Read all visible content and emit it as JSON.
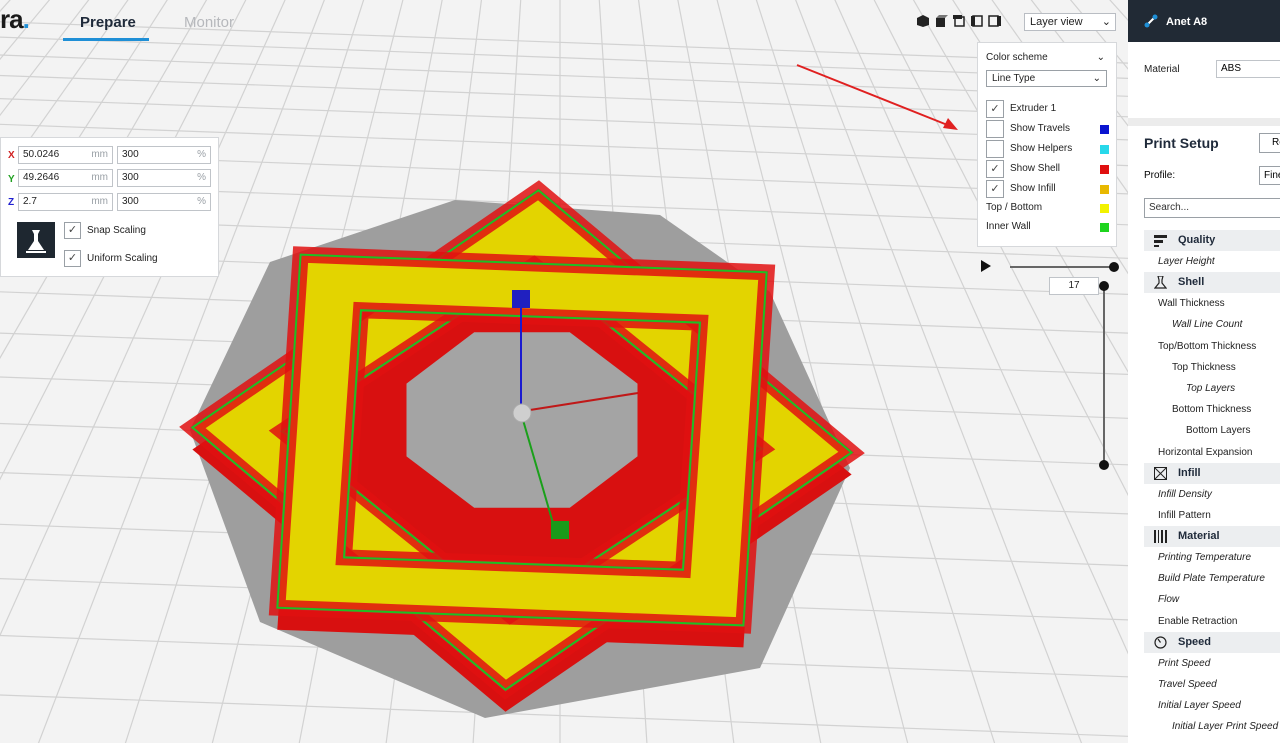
{
  "app": {
    "logo_text": "ra",
    "logo_dot": "."
  },
  "tabs": {
    "prepare": "Prepare",
    "monitor": "Monitor"
  },
  "view": {
    "selected": "Layer view",
    "icons": [
      "3d-view-icon",
      "front-view-icon",
      "top-view-icon",
      "left-view-icon",
      "right-view-icon"
    ]
  },
  "layer_panel": {
    "color_scheme_label": "Color scheme",
    "scheme_value": "Line Type",
    "items": [
      {
        "label": "Extruder 1",
        "checked": "✓"
      },
      {
        "label": "Show Travels",
        "checked": "",
        "color": "#0a14d0"
      },
      {
        "label": "Show Helpers",
        "checked": "",
        "color": "#28d8ea"
      },
      {
        "label": "Show Shell",
        "checked": "✓",
        "color": "#e01010"
      },
      {
        "label": "Show Infill",
        "checked": "✓",
        "color": "#e8b800"
      }
    ],
    "legend": [
      {
        "label": "Top / Bottom",
        "color": "#f2f200"
      },
      {
        "label": "Inner Wall",
        "color": "#1ed41e"
      }
    ],
    "current_layer": "17"
  },
  "scale": {
    "x": {
      "axis": "X",
      "value": "50.0246",
      "unit": "mm",
      "percent": "300",
      "pct_unit": "%"
    },
    "y": {
      "axis": "Y",
      "value": "49.2646",
      "unit": "mm",
      "percent": "300",
      "pct_unit": "%"
    },
    "z": {
      "axis": "Z",
      "value": "2.7",
      "unit": "mm",
      "percent": "300",
      "pct_unit": "%"
    },
    "snap_label": "Snap Scaling",
    "uniform_label": "Uniform Scaling",
    "check": "✓"
  },
  "sidebar": {
    "printer": "Anet A8",
    "material_label": "Material",
    "material_value": "ABS",
    "print_setup": "Print Setup",
    "print_setup_btn": "Re",
    "profile_label": "Profile:",
    "profile_value": "Fine",
    "search_placeholder": "Search...",
    "categories": [
      {
        "label": "Quality",
        "icon": "quality-icon",
        "items": [
          {
            "label": "Layer Height",
            "level": 1,
            "italic": true
          }
        ]
      },
      {
        "label": "Shell",
        "icon": "shell-icon",
        "items": [
          {
            "label": "Wall Thickness",
            "level": 1,
            "italic": false
          },
          {
            "label": "Wall Line Count",
            "level": 2,
            "italic": true
          },
          {
            "label": "Top/Bottom Thickness",
            "level": 1,
            "italic": false
          },
          {
            "label": "Top Thickness",
            "level": 2,
            "italic": false
          },
          {
            "label": "Top Layers",
            "level": 3,
            "italic": true
          },
          {
            "label": "Bottom Thickness",
            "level": 2,
            "italic": false
          },
          {
            "label": "Bottom Layers",
            "level": 3,
            "italic": false
          },
          {
            "label": "Horizontal Expansion",
            "level": 1,
            "italic": false
          }
        ]
      },
      {
        "label": "Infill",
        "icon": "infill-icon",
        "items": [
          {
            "label": "Infill Density",
            "level": 1,
            "italic": true
          },
          {
            "label": "Infill Pattern",
            "level": 1,
            "italic": false
          }
        ]
      },
      {
        "label": "Material",
        "icon": "material-icon",
        "items": [
          {
            "label": "Printing Temperature",
            "level": 1,
            "italic": true
          },
          {
            "label": "Build Plate Temperature",
            "level": 1,
            "italic": true
          },
          {
            "label": "Flow",
            "level": 1,
            "italic": true
          },
          {
            "label": "Enable Retraction",
            "level": 1,
            "italic": false
          }
        ]
      },
      {
        "label": "Speed",
        "icon": "speed-icon",
        "items": [
          {
            "label": "Print Speed",
            "level": 1,
            "italic": true
          },
          {
            "label": "Travel Speed",
            "level": 1,
            "italic": true
          },
          {
            "label": "Initial Layer Speed",
            "level": 1,
            "italic": true
          },
          {
            "label": "Initial Layer Print Speed",
            "level": 2,
            "italic": true
          }
        ]
      }
    ]
  }
}
